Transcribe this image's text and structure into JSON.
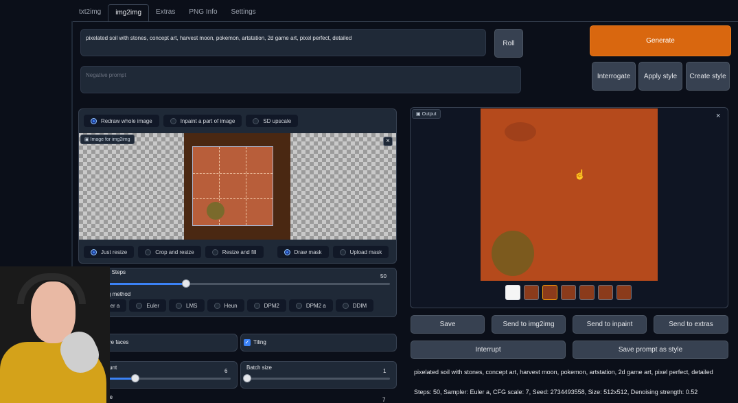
{
  "tabs": [
    "txt2img",
    "img2img",
    "Extras",
    "PNG Info",
    "Settings"
  ],
  "active_tab": "img2img",
  "prompt": "pixelated soil with stones, concept art, harvest moon, pokemon, artstation, 2d game art, pixel perfect, detailed",
  "negative_prompt_placeholder": "Negative prompt",
  "buttons": {
    "roll": "Roll",
    "generate": "Generate",
    "interrogate": "Interrogate",
    "apply_style": "Apply style",
    "create_style": "Create style",
    "save": "Save",
    "send_img2img": "Send to img2img",
    "send_inpaint": "Send to inpaint",
    "send_extras": "Send to extras",
    "interrupt": "Interrupt",
    "save_prompt_style": "Save prompt as style"
  },
  "mode_options": [
    "Redraw whole image",
    "Inpaint a part of image",
    "SD upscale"
  ],
  "mode_selected": "Redraw whole image",
  "image_label": "Image for img2img",
  "output_label": "Output",
  "resize_options": [
    "Just resize",
    "Crop and resize",
    "Resize and fill"
  ],
  "resize_selected": "Just resize",
  "mask_options": [
    "Draw mask",
    "Upload mask"
  ],
  "mask_selected": "Draw mask",
  "sampling_steps": {
    "label": "Sampling Steps",
    "value": "50",
    "fraction": 0.33
  },
  "sampling_method": {
    "label": "Sampling method",
    "options": [
      "Euler a",
      "Euler",
      "LMS",
      "Heun",
      "DPM2",
      "DPM2 a",
      "DDIM"
    ],
    "selected": "Euler a"
  },
  "restore_faces": "Restore faces",
  "tiling": "Tiling",
  "batch_count": {
    "label": "Batch count",
    "value": "6"
  },
  "batch_size": {
    "label": "Batch size",
    "value": "1"
  },
  "cfg_label": "Scale",
  "cfg_value": "7",
  "info_text": "pixelated soil with stones, concept art, harvest moon, pokemon, artstation, 2d game art, pixel perfect, detailed",
  "info_params": "Steps: 50, Sampler: Euler a, CFG scale: 7, Seed: 2734493558, Size: 512x512, Denoising strength: 0.52"
}
